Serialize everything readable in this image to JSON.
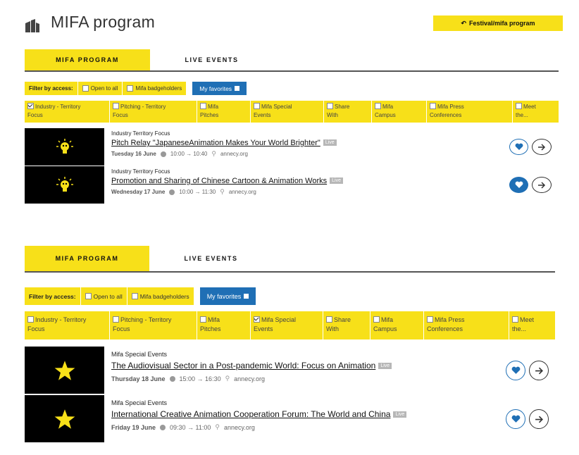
{
  "header": {
    "title": "MIFA program",
    "festival_button": "Festival/mifa program"
  },
  "tabs": {
    "program": "MIFA PROGRAM",
    "live": "LIVE EVENTS"
  },
  "filters": {
    "label": "Filter by access:",
    "open": "Open to all",
    "badge": "Mifa badgeholders",
    "favorites": "My favorites"
  },
  "categories": {
    "industry": [
      "Industry - Territory",
      "Focus"
    ],
    "pitching": [
      "Pitching - Territory",
      "Focus"
    ],
    "mifa_pitches": [
      "Mifa",
      "Pitches"
    ],
    "special": [
      "Mifa Special",
      "Events"
    ],
    "share": [
      "Share",
      "With"
    ],
    "campus": [
      "Mifa",
      "Campus"
    ],
    "press": [
      "Mifa Press",
      "Conferences"
    ],
    "meet": [
      "Meet",
      "the..."
    ]
  },
  "section1": {
    "checked_category": "industry",
    "events": [
      {
        "category": "Industry Territory Focus",
        "title": "Pitch Relay \"JapaneseAnimation Makes Your World Brighter\"",
        "live": "Live",
        "date": "Tuesday 16 June",
        "time": "10:00 → 10:40",
        "location": "annecy.org",
        "favorite": false
      },
      {
        "category": "Industry Territory Focus",
        "title": "Promotion and Sharing of Chinese Cartoon & Animation Works",
        "live": "Live",
        "date": "Wednesday 17 June",
        "time": "10:00 → 11:30",
        "location": "annecy.org",
        "favorite": true
      }
    ]
  },
  "section2": {
    "checked_category": "special",
    "events": [
      {
        "category": "Mifa Special Events",
        "title": "The Audiovisual Sector in a Post-pandemic World: Focus on Animation",
        "live": "Live",
        "date": "Thursday 18 June",
        "time": "15:00 → 16:30",
        "location": "annecy.org",
        "favorite": false
      },
      {
        "category": "Mifa Special Events",
        "title": "International Creative Animation Cooperation Forum: The World and China",
        "live": "Live",
        "date": "Friday 19 June",
        "time": "09:30 → 11:00",
        "location": "annecy.org",
        "favorite": false
      }
    ]
  },
  "colors": {
    "accent": "#f7e019",
    "blue": "#1f6fb5"
  }
}
